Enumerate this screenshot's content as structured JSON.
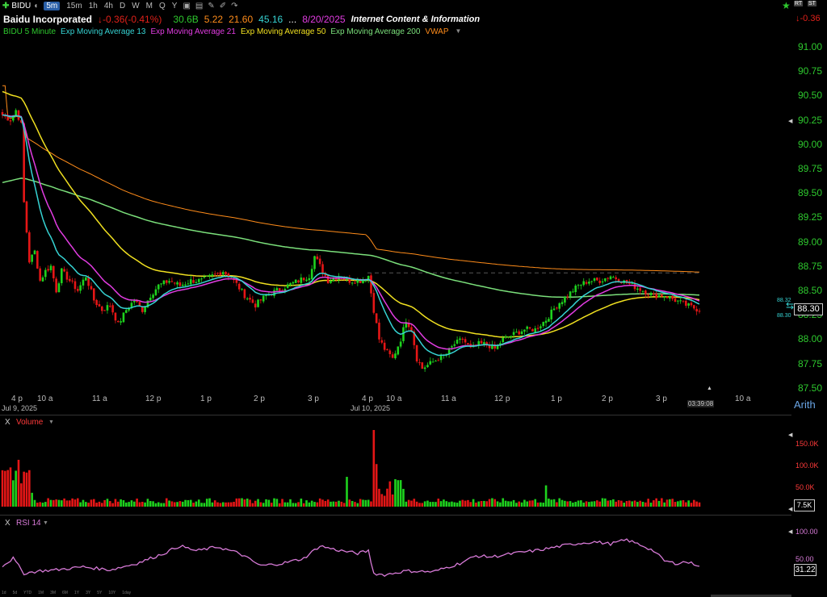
{
  "toolbar": {
    "symbol": "BIDU",
    "timeframes": [
      "5m",
      "15m",
      "1h",
      "4h",
      "D",
      "W",
      "M",
      "Q",
      "Y"
    ],
    "active_timeframe": "5m",
    "right_change": "-0.36",
    "right_badges": [
      "RT",
      "ST"
    ]
  },
  "header": {
    "name": "Baidu Incorporated",
    "change": "-0.36(-0.41%)",
    "market_cap": "30.6B",
    "pe": "5.22",
    "v1": "21.60",
    "v2": "45.16",
    "dots": "...",
    "date": "8/20/2025",
    "industry": "Internet Content & Information"
  },
  "legend": [
    {
      "label": "BIDU 5 Minute",
      "color": "#2ec92e"
    },
    {
      "label": "Exp Moving Average 13",
      "color": "#36d3d3"
    },
    {
      "label": "Exp Moving Average 21",
      "color": "#e23ce2"
    },
    {
      "label": "Exp Moving Average 50",
      "color": "#f0e020"
    },
    {
      "label": "Exp Moving Average 200",
      "color": "#7be07b"
    },
    {
      "label": "VWAP",
      "color": "#ff8c1a"
    }
  ],
  "price_axis": [
    "91.00",
    "90.75",
    "90.50",
    "90.25",
    "90.00",
    "89.75",
    "89.50",
    "89.25",
    "89.00",
    "88.75",
    "88.50",
    "88.25",
    "88.00",
    "87.75",
    "87.50"
  ],
  "price_tags": {
    "upper": "88.32",
    "lower": "88.30"
  },
  "last_price": "88.30",
  "scale_mode": "Arith",
  "time_axis": [
    "4 p",
    "10 a",
    "11 a",
    "12 p",
    "1 p",
    "2 p",
    "3 p",
    "4 p",
    "10 a",
    "11 a",
    "12 p",
    "1 p",
    "2 p",
    "3 p",
    "10 a"
  ],
  "dates": {
    "left": "Jul 9, 2025",
    "middle": "Jul 10, 2025"
  },
  "clock": "03:39:08",
  "volume": {
    "title": "Volume",
    "axis": [
      "150.0K",
      "100.0K",
      "50.0K"
    ],
    "last": "7.5K",
    "close_label": "X"
  },
  "rsi": {
    "title": "RSI 14",
    "axis": [
      "100.00",
      "50.00"
    ],
    "last": "31.22",
    "close_label": "X"
  },
  "range_bar": [
    "1d",
    "5d",
    "YTD",
    "1M",
    "3M",
    "6M",
    "1Y",
    "3Y",
    "5Y",
    "10Y",
    "1day"
  ],
  "colors": {
    "up": "#1ed21e",
    "down": "#e51616",
    "ema13": "#36d3d3",
    "ema21": "#e23ce2",
    "ema50": "#f0e020",
    "ema200": "#7be07b",
    "vwap": "#ff8c1a",
    "rsi": "#d77ad7"
  },
  "icons": [
    "star-icon",
    "flag-icon",
    "settings-icon",
    "clipboard-icon",
    "pen-icon",
    "pencil-icon",
    "undo-icon",
    "redo-icon",
    "camera-icon"
  ],
  "chart_data": {
    "type": "candlestick",
    "title": "",
    "ylim": [
      87.5,
      91.0
    ],
    "series": [
      {
        "name": "BIDU 5 Minute",
        "candles_approx": [
          {
            "t": "Jul 9 4 p",
            "o": 90.35,
            "h": 90.4,
            "c": 90.2
          },
          {
            "t": "Jul 9 10 a",
            "o": 89.0,
            "h": 89.1,
            "c": 88.75
          },
          {
            "t": "Jul 9 11 a",
            "o": 88.5,
            "h": 88.55,
            "c": 88.15
          },
          {
            "t": "Jul 9 12 p",
            "o": 88.5,
            "h": 88.6,
            "c": 88.55
          },
          {
            "t": "Jul 9 1 p",
            "o": 88.6,
            "h": 88.65,
            "c": 88.55
          },
          {
            "t": "Jul 9 3 p",
            "o": 88.8,
            "h": 88.95,
            "c": 88.6
          },
          {
            "t": "Jul 10 4 p",
            "o": 88.6,
            "h": 88.8,
            "c": 88.3
          },
          {
            "t": "Jul 10 10 a",
            "o": 88.0,
            "h": 88.1,
            "c": 87.8
          },
          {
            "t": "Jul 10 11 a",
            "o": 87.85,
            "h": 88.0,
            "c": 87.95
          },
          {
            "t": "Jul 10 12 p",
            "o": 87.95,
            "h": 88.05,
            "c": 88.0
          },
          {
            "t": "Jul 10 1 p",
            "o": 88.2,
            "h": 88.3,
            "c": 88.35
          },
          {
            "t": "Jul 10 2 p",
            "o": 88.6,
            "h": 88.65,
            "c": 88.55
          },
          {
            "t": "Jul 10 3 p",
            "o": 88.45,
            "h": 88.5,
            "c": 88.3
          }
        ]
      },
      {
        "name": "Exp Moving Average 200",
        "values_approx": [
          89.45,
          89.3,
          89.15,
          89.05,
          88.95,
          88.85,
          88.7,
          88.65,
          88.62,
          88.58
        ]
      },
      {
        "name": "VWAP",
        "values_approx": [
          90.5,
          88.9,
          88.6,
          88.6,
          88.6,
          88.55,
          88.3,
          87.95,
          88.0,
          88.1,
          88.15
        ]
      }
    ],
    "rsi_range": [
      0,
      100
    ],
    "volume_max": 180000
  }
}
